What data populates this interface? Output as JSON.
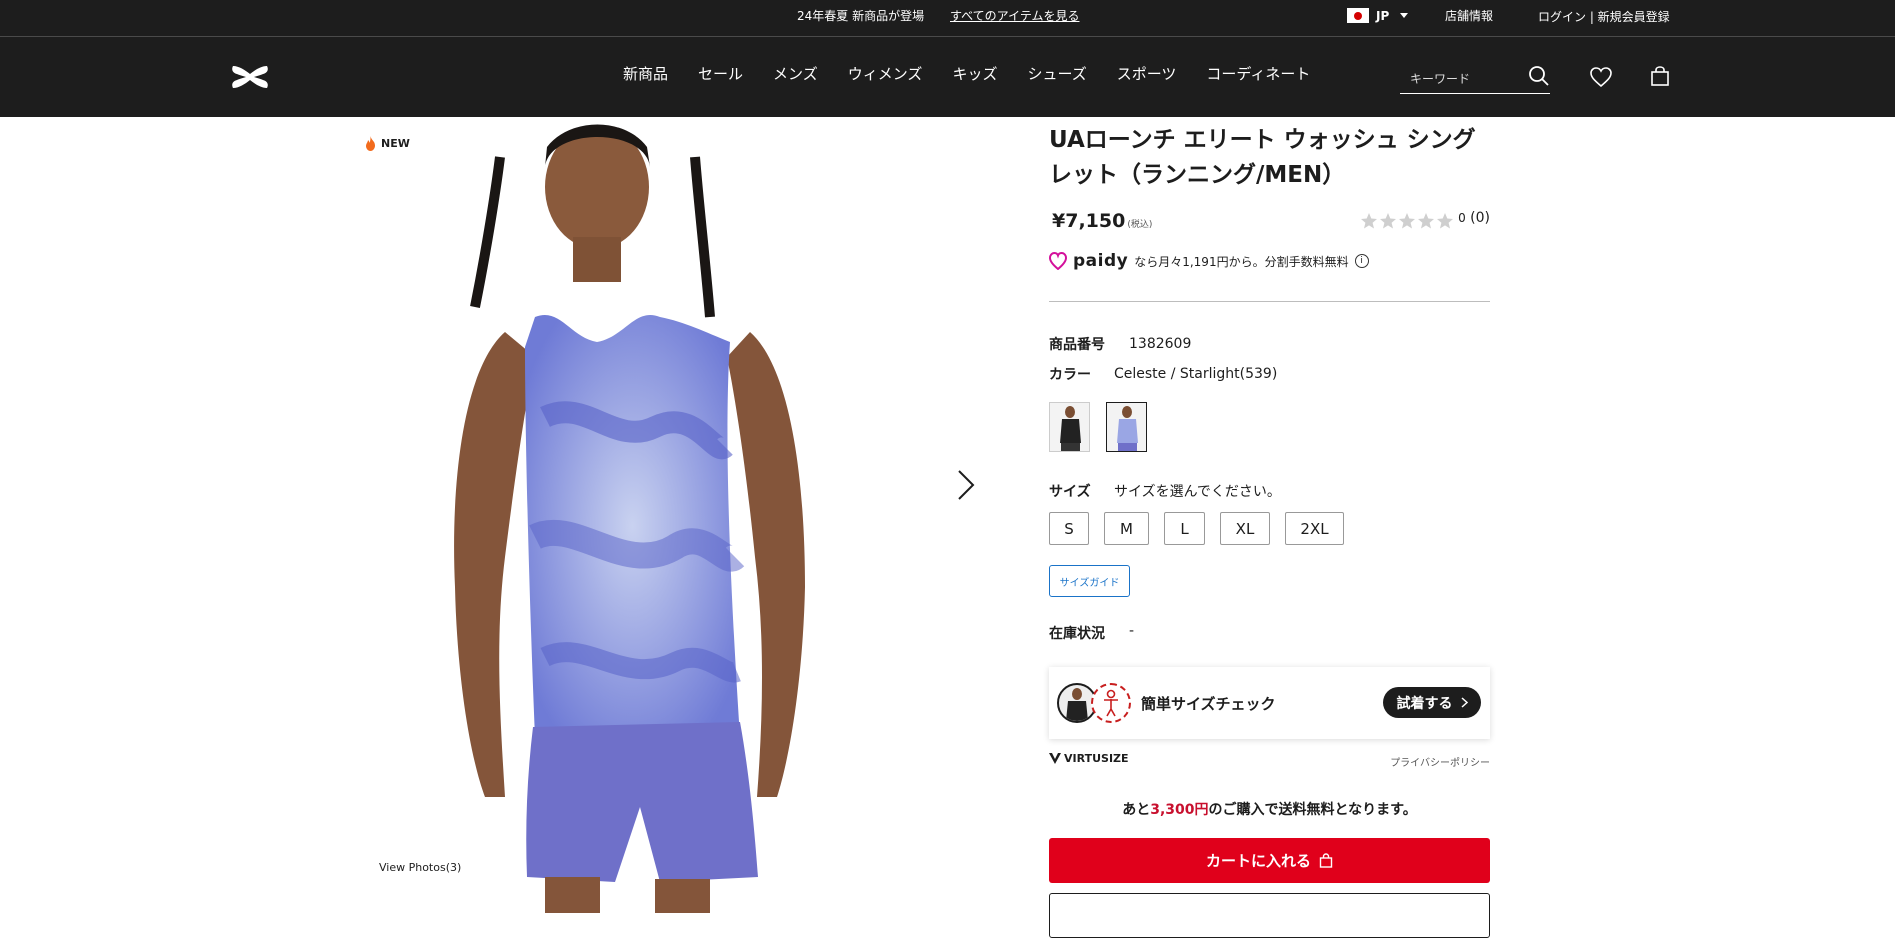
{
  "topbar": {
    "promo_text": "24年春夏 新商品が登場",
    "promo_link": "すべてのアイテムを見る",
    "lang": "JP",
    "store": "店舗情報",
    "login": "ログイン | 新規会員登録"
  },
  "nav": {
    "items": [
      "新商品",
      "セール",
      "メンズ",
      "ウィメンズ",
      "キッズ",
      "シューズ",
      "スポーツ",
      "コーディネート"
    ],
    "search_placeholder": "キーワード"
  },
  "gallery": {
    "badge": "NEW",
    "view_photos": "View Photos(3)"
  },
  "product": {
    "title": "UAローンチ エリート ウォッシュ シングレット（ランニング/MEN）",
    "price": "¥7,150",
    "tax": "(税込)",
    "rating_stars": 0,
    "review_count": "0",
    "review_paren": "(0)",
    "paidy_logo": "paidy",
    "paidy_text": "なら月々1,191円から。分割手数料無料",
    "sku_label": "商品番号",
    "sku_value": "1382609",
    "color_label": "カラー",
    "color_value": "Celeste / Starlight(539)",
    "size_label": "サイズ",
    "size_prompt": "サイズを選んでください。",
    "sizes": [
      "S",
      "M",
      "L",
      "XL",
      "2XL"
    ],
    "size_guide": "サイズガイド",
    "stock_label": "在庫状況",
    "stock_value": "-"
  },
  "virtusize": {
    "label": "簡単サイズチェック",
    "try_button": "試着する",
    "brand": "VIRTUSIZE",
    "privacy": "プライバシーポリシー"
  },
  "shipping": {
    "prefix": "あと",
    "amount": "3,300円",
    "suffix": "のご購入で送料無料となります。"
  },
  "cart_button": "カートに入れる",
  "colors": {
    "brand_dark": "#1d1d1d",
    "cart_red": "#e0001b",
    "link_blue": "#1a73c8"
  }
}
